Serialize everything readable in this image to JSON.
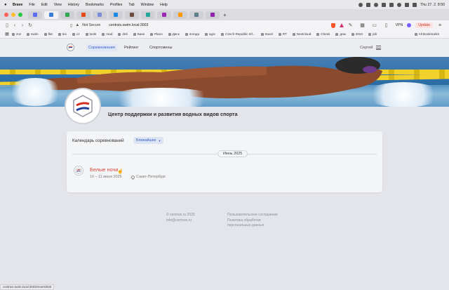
{
  "menubar": {
    "app": "Brave",
    "items": [
      "File",
      "Edit",
      "View",
      "History",
      "Bookmarks",
      "Profiles",
      "Tab",
      "Window",
      "Help"
    ],
    "clock": "Thu 27. 2.  8:50"
  },
  "toolbar": {
    "security": "Not Secure",
    "url": "centrws.swim.local:3003",
    "vpn": "VPN",
    "update": "Update"
  },
  "bookmarks": {
    "items": [
      "zoz",
      "swim",
      "flat",
      "tex",
      "cz",
      "tools",
      "read",
      "deti",
      "Банк",
      "Plano",
      "Диск",
      "погода",
      "курс",
      "Czech Republic Inf...",
      "travel",
      "RT",
      "Nextcloud",
      "Chess",
      "дом",
      "2023",
      "job"
    ],
    "all": "All Bookmarks"
  },
  "site": {
    "nav": [
      "Соревнования",
      "Рейтинг",
      "Спортсмены"
    ],
    "user": "Сергей",
    "org_title": "Центр поддержки и развития водных видов спорта"
  },
  "calendar": {
    "title": "Календарь соревнований",
    "filter": "Ближайшие",
    "month": "Июнь 2025",
    "event": {
      "title": "Белые ночи",
      "dates": "10 – 11 июня 2025",
      "location": "Санкт-Петербург"
    }
  },
  "footer": {
    "left": [
      "© centrws.ru 2025",
      "info@centrws.ru"
    ],
    "right": [
      "Пользовательское соглашение",
      "Политика обработки",
      "персональных данных"
    ]
  },
  "status_url": "centrws.swim.local:3003/meets/845",
  "colors": {
    "accent": "#3a63c7",
    "event_title": "#d9453b",
    "flag_red": "#d52b1e",
    "flag_blue": "#1f3f9a"
  }
}
